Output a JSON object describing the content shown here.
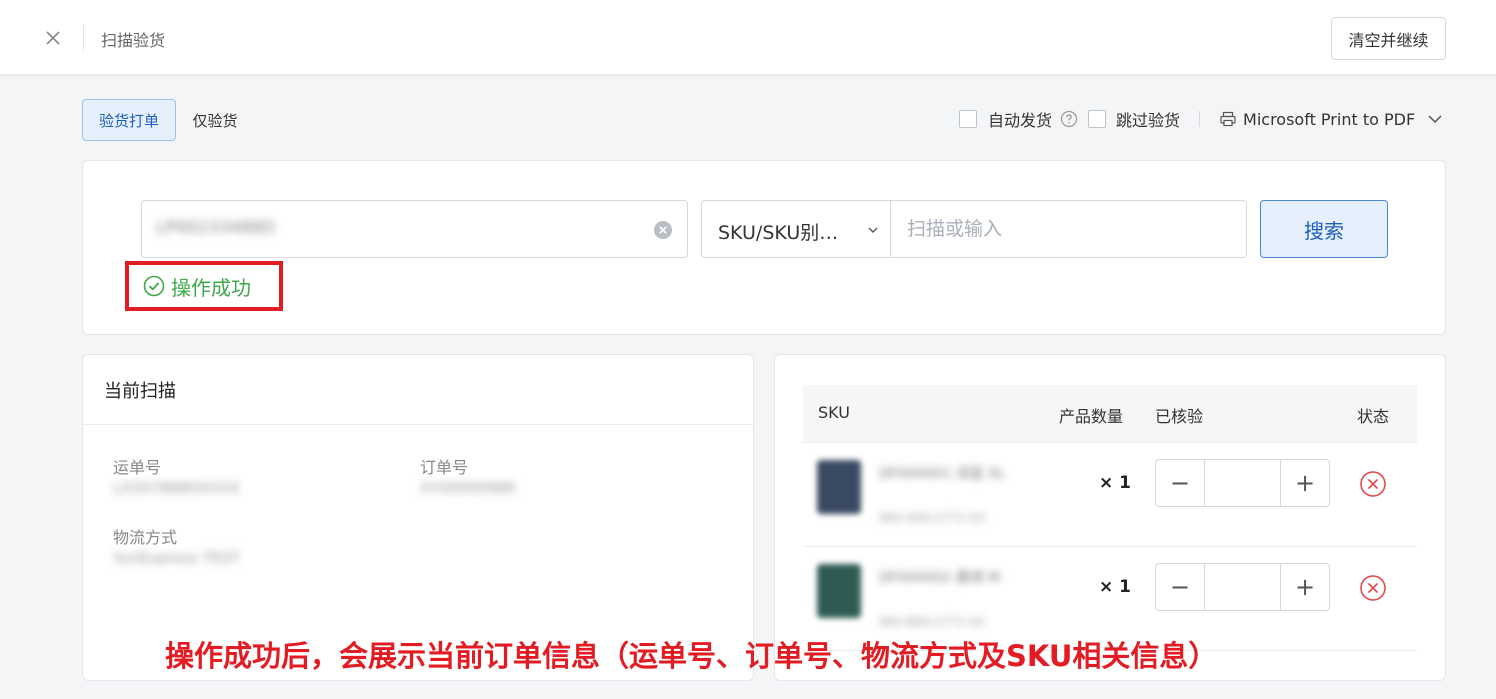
{
  "header": {
    "title": "扫描验货",
    "clear_continue_label": "清空并继续"
  },
  "modes": [
    {
      "label": "验货打单",
      "active": true
    },
    {
      "label": "仅验货",
      "active": false
    }
  ],
  "options": {
    "auto_ship_label": "自动发货",
    "skip_inspect_label": "跳过验货",
    "printer_label": "Microsoft Print to PDF"
  },
  "search": {
    "tracking_value": "LP00233488D",
    "field_select_value": "SKU/SKU别…",
    "scan_placeholder": "扫描或输入",
    "search_label": "搜索",
    "success_message": "操作成功"
  },
  "current_scan": {
    "title": "当前扫描",
    "tracking_label": "运单号",
    "tracking_value": "LX3078880XXXX",
    "order_label": "订单号",
    "order_value": "XY0000098K",
    "shipping_label": "物流方式",
    "shipping_value": "YunExpress TEST"
  },
  "sku_table": {
    "headers": [
      "SKU",
      "产品数量",
      "已核验",
      "状态"
    ],
    "rows": [
      {
        "name": "DF000001 深蓝 XL",
        "sub": "SKU-A00-2771-S3",
        "quantity": "× 1",
        "thumb_color": "#3a4a62"
      },
      {
        "name": "DF000002 墨绿 M",
        "sub": "SKU-B00-2771-S2",
        "quantity": "× 1",
        "thumb_color": "#2f5b54"
      }
    ]
  },
  "annotation": "操作成功后，会展示当前订单信息（运单号、订单号、物流方式及SKU相关信息）",
  "colors": {
    "primary": "#1f5fbf",
    "success": "#3fa84a",
    "alert_red": "#e31c23"
  }
}
